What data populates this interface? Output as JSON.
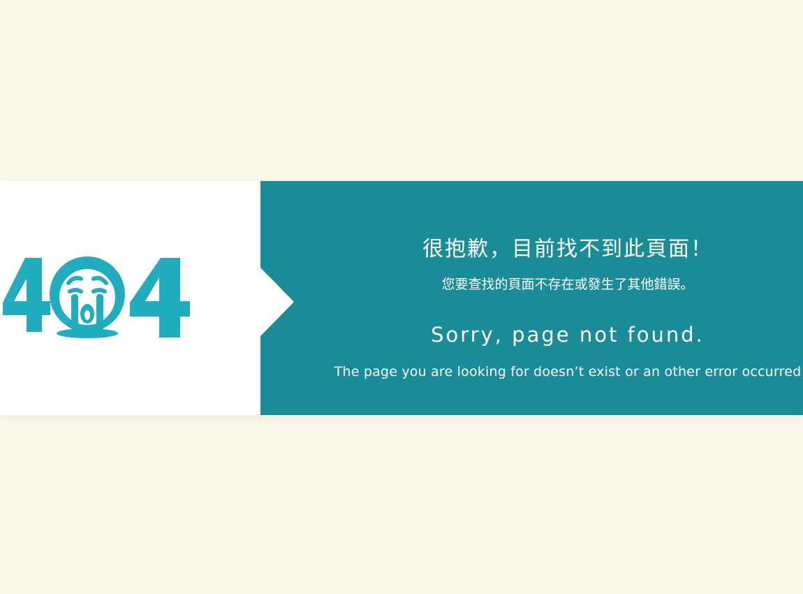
{
  "colors": {
    "background": "#fdf8ec",
    "panel_left": "#ffffff",
    "panel_right": "#1a8c98",
    "logo": "#22adbf",
    "text": "#ffffff"
  },
  "logo": {
    "text": "404",
    "icon": "crying-face-icon"
  },
  "message": {
    "zh_title": "很抱歉，目前找不到此頁面！",
    "zh_subtitle": "您要查找的頁面不存在或發生了其他錯誤。",
    "en_title": "Sorry, page not found.",
    "en_subtitle": "The page you are looking for doesn’t exist or an other error occurred"
  }
}
